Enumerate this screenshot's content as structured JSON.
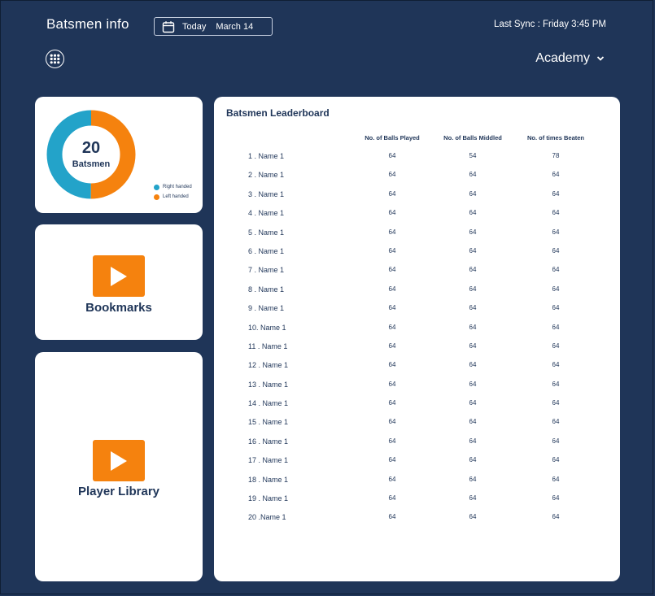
{
  "header": {
    "title": "Batsmen info",
    "date_today": "Today",
    "date_value": "March 14",
    "last_sync": "Last Sync : Friday 3:45 PM",
    "academy": "Academy"
  },
  "summary": {
    "count": "20",
    "label": "Batsmen",
    "legend": [
      {
        "label": "Right handed",
        "color": "#23a3c9"
      },
      {
        "label": "Left handed",
        "color": "#f5820e"
      }
    ],
    "split": {
      "right_handed": 50,
      "left_handed": 50
    }
  },
  "bookmarks": {
    "label": "Bookmarks"
  },
  "library": {
    "label": "Player Library"
  },
  "leaderboard": {
    "title": "Batsmen Leaderboard",
    "columns": [
      "No. of Balls Played",
      "No. of Balls Middled",
      "No. of times Beaten"
    ],
    "rows": [
      {
        "name": "1 . Name 1",
        "played": "64",
        "middled": "54",
        "beaten": "78"
      },
      {
        "name": "2 . Name 1",
        "played": "64",
        "middled": "64",
        "beaten": "64"
      },
      {
        "name": "3 . Name 1",
        "played": "64",
        "middled": "64",
        "beaten": "64"
      },
      {
        "name": "4 . Name 1",
        "played": "64",
        "middled": "64",
        "beaten": "64"
      },
      {
        "name": "5 . Name 1",
        "played": "64",
        "middled": "64",
        "beaten": "64"
      },
      {
        "name": "6 . Name 1",
        "played": "64",
        "middled": "64",
        "beaten": "64"
      },
      {
        "name": "7 . Name 1",
        "played": "64",
        "middled": "64",
        "beaten": "64"
      },
      {
        "name": "8 . Name 1",
        "played": "64",
        "middled": "64",
        "beaten": "64"
      },
      {
        "name": "9 . Name 1",
        "played": "64",
        "middled": "64",
        "beaten": "64"
      },
      {
        "name": "10. Name 1",
        "played": "64",
        "middled": "64",
        "beaten": "64"
      },
      {
        "name": "11 . Name 1",
        "played": "64",
        "middled": "64",
        "beaten": "64"
      },
      {
        "name": "12 . Name 1",
        "played": "64",
        "middled": "64",
        "beaten": "64"
      },
      {
        "name": "13 . Name 1",
        "played": "64",
        "middled": "64",
        "beaten": "64"
      },
      {
        "name": "14 . Name 1",
        "played": "64",
        "middled": "64",
        "beaten": "64"
      },
      {
        "name": "15 . Name 1",
        "played": "64",
        "middled": "64",
        "beaten": "64"
      },
      {
        "name": "16 . Name 1",
        "played": "64",
        "middled": "64",
        "beaten": "64"
      },
      {
        "name": "17 . Name 1",
        "played": "64",
        "middled": "64",
        "beaten": "64"
      },
      {
        "name": "18 . Name 1",
        "played": "64",
        "middled": "64",
        "beaten": "64"
      },
      {
        "name": "19 . Name 1",
        "played": "64",
        "middled": "64",
        "beaten": "64"
      },
      {
        "name": "20 .Name 1",
        "played": "64",
        "middled": "64",
        "beaten": "64"
      }
    ]
  },
  "colors": {
    "background": "#1f3558",
    "accent": "#f5820e",
    "right_handed": "#23a3c9",
    "card": "#ffffff"
  },
  "icons": {
    "calendar": "calendar-icon",
    "apps": "apps-grid-icon",
    "dropdown": "chevron-down-icon",
    "play": "play-icon"
  }
}
